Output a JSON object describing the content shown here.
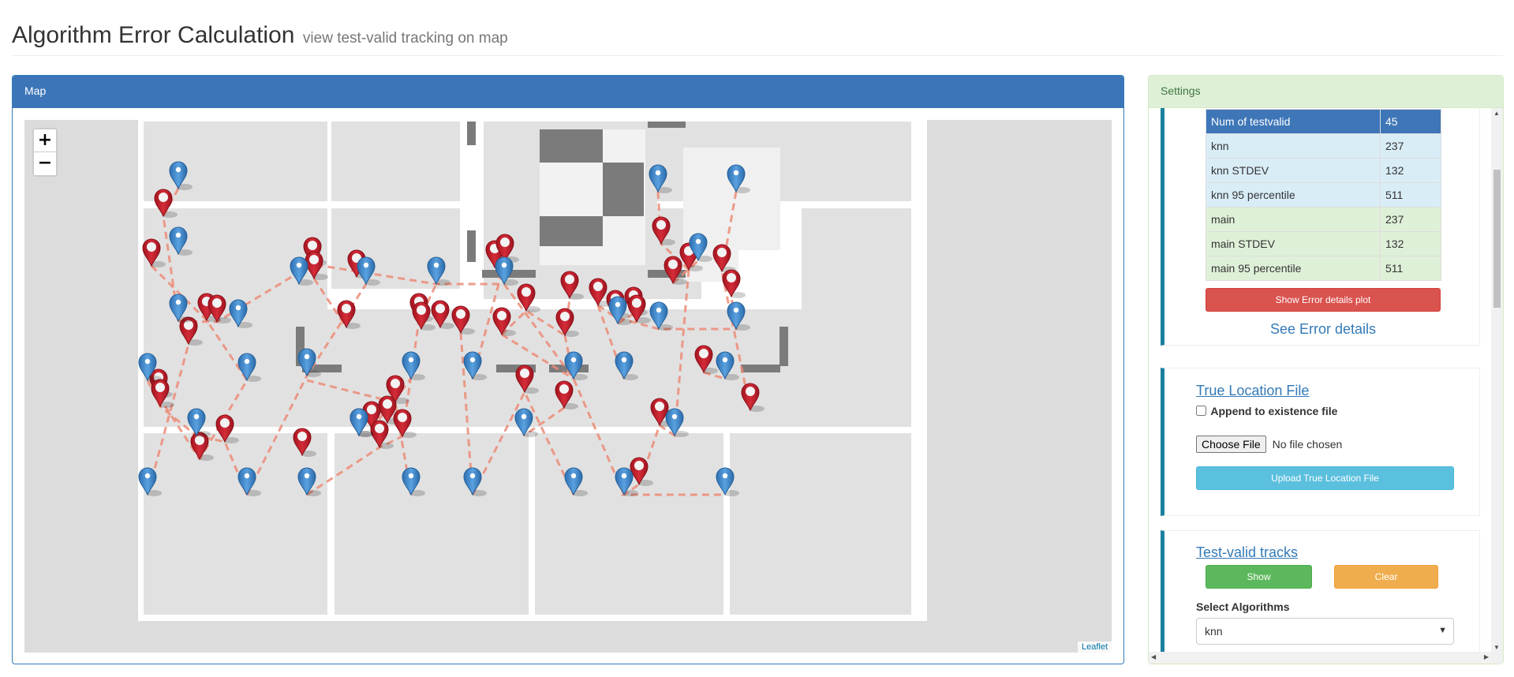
{
  "header": {
    "title": "Algorithm Error Calculation",
    "subtitle": "view test-valid tracking on map"
  },
  "map_panel": {
    "title": "Map",
    "zoom_in": "+",
    "zoom_out": "−",
    "attribution": "Leaflet",
    "colors": {
      "true_marker": "#3b82c4",
      "estimated_marker": "#c0202c",
      "track_line": "#ec8b77",
      "floor_bg": "#dcdcdc",
      "room": "#e1e1e1",
      "wall": "#ffffff"
    },
    "icons": {
      "true_marker": "map-marker-blue-icon",
      "estimated_marker": "map-marker-red-icon"
    }
  },
  "settings_panel": {
    "title": "Settings",
    "results_table": [
      {
        "label": "Num of testvalid",
        "value": "45",
        "style": "head"
      },
      {
        "label": "knn",
        "value": "237",
        "style": "blue"
      },
      {
        "label": "knn STDEV",
        "value": "132",
        "style": "blue"
      },
      {
        "label": "knn 95 percentile",
        "value": "511",
        "style": "blue"
      },
      {
        "label": "main",
        "value": "237",
        "style": "green"
      },
      {
        "label": "main STDEV",
        "value": "132",
        "style": "green"
      },
      {
        "label": "main 95 percentile",
        "value": "511",
        "style": "green"
      }
    ],
    "show_error_plot_button": "Show Error details plot",
    "see_error_details_link": "See Error details",
    "true_location": {
      "title": "True Location File",
      "append_checkbox_label": "Append to existence file",
      "append_checked": false,
      "choose_file_button": "Choose File",
      "file_status": "No file chosen",
      "upload_button": "Upload True Location File"
    },
    "tracks": {
      "title": "Test-valid tracks",
      "show_button": "Show",
      "clear_button": "Clear",
      "select_label": "Select Algorithms",
      "selected_algorithm": "knn"
    }
  }
}
